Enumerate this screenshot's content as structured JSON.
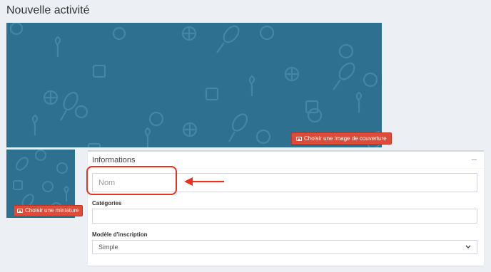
{
  "page": {
    "title": "Nouvelle activité"
  },
  "cover": {
    "button_label": "Choisir une image de couverture",
    "background_color": "#2e7090"
  },
  "thumbnail": {
    "button_label": "Choisir une miniature"
  },
  "panel": {
    "title": "Informations",
    "collapse_symbol": "–",
    "name_field": {
      "placeholder": "Nom"
    },
    "categories": {
      "label": "Catégories",
      "value": ""
    },
    "registration_model": {
      "label": "Modèle d'inscription",
      "value": "Simple"
    }
  },
  "colors": {
    "accent_red": "#dd4b39",
    "highlight": "#e8321f",
    "page_bg": "#ecf0f5"
  },
  "icons": [
    "image-icon",
    "chevron-down-icon",
    "arrow-left-icon"
  ]
}
